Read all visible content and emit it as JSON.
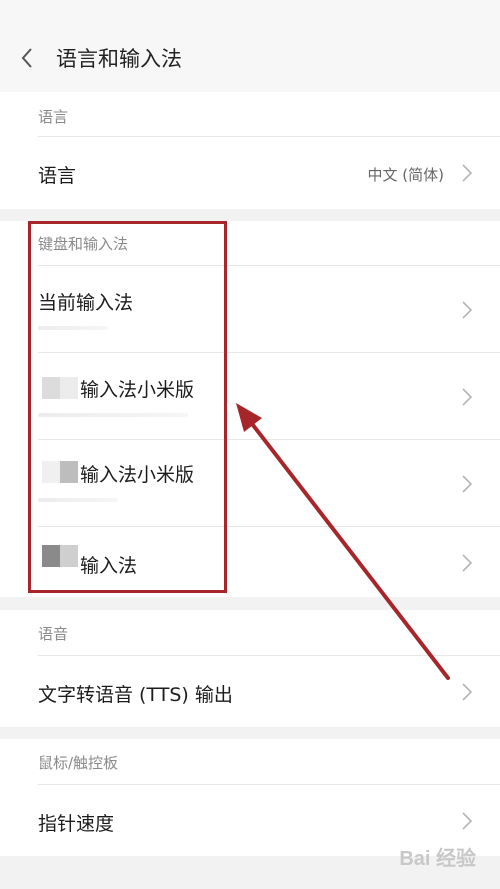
{
  "header": {
    "title": "语言和输入法"
  },
  "sections": {
    "language": {
      "label": "语言",
      "row": {
        "label": "语言",
        "value": "中文 (简体)"
      }
    },
    "keyboard": {
      "label": "键盘和输入法",
      "rows": [
        {
          "label": "当前输入法"
        },
        {
          "label": "输入法小米版"
        },
        {
          "label": "输入法小米版"
        },
        {
          "label": "输入法"
        }
      ]
    },
    "speech": {
      "label": "语音",
      "row": {
        "label": "文字转语音 (TTS) 输出"
      }
    },
    "mouse": {
      "label": "鼠标/触控板",
      "row": {
        "label": "指针速度"
      }
    }
  },
  "colors": {
    "annotation": "#a6262a",
    "background": "#f2f2f2"
  },
  "watermark": "Bai 经验"
}
